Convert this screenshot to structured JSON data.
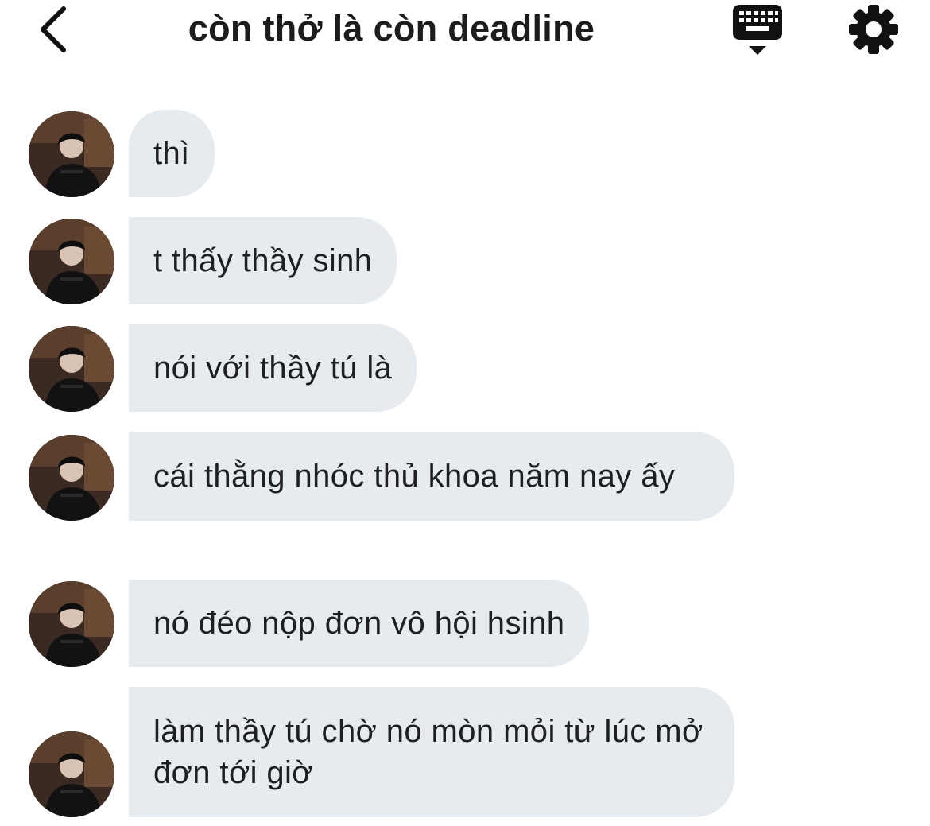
{
  "header": {
    "title": "còn thở là còn deadline",
    "back_icon": "chevron-left-icon",
    "keyboard_icon": "keyboard-icon",
    "settings_icon": "gear-icon"
  },
  "messages": [
    {
      "text": "thì"
    },
    {
      "text": "t thấy thầy sinh"
    },
    {
      "text": "nói với thầy tú là"
    },
    {
      "text": "cái thằng nhóc thủ khoa năm nay ấy"
    },
    {
      "text": "nó đéo nộp đơn vô hội hsinh"
    },
    {
      "text": "làm thầy tú chờ nó mòn mỏi từ lúc mở đơn tới giờ"
    }
  ],
  "colors": {
    "bubble_bg": "#e6ebf0",
    "text": "#1c1c1e",
    "background": "#ffffff"
  }
}
